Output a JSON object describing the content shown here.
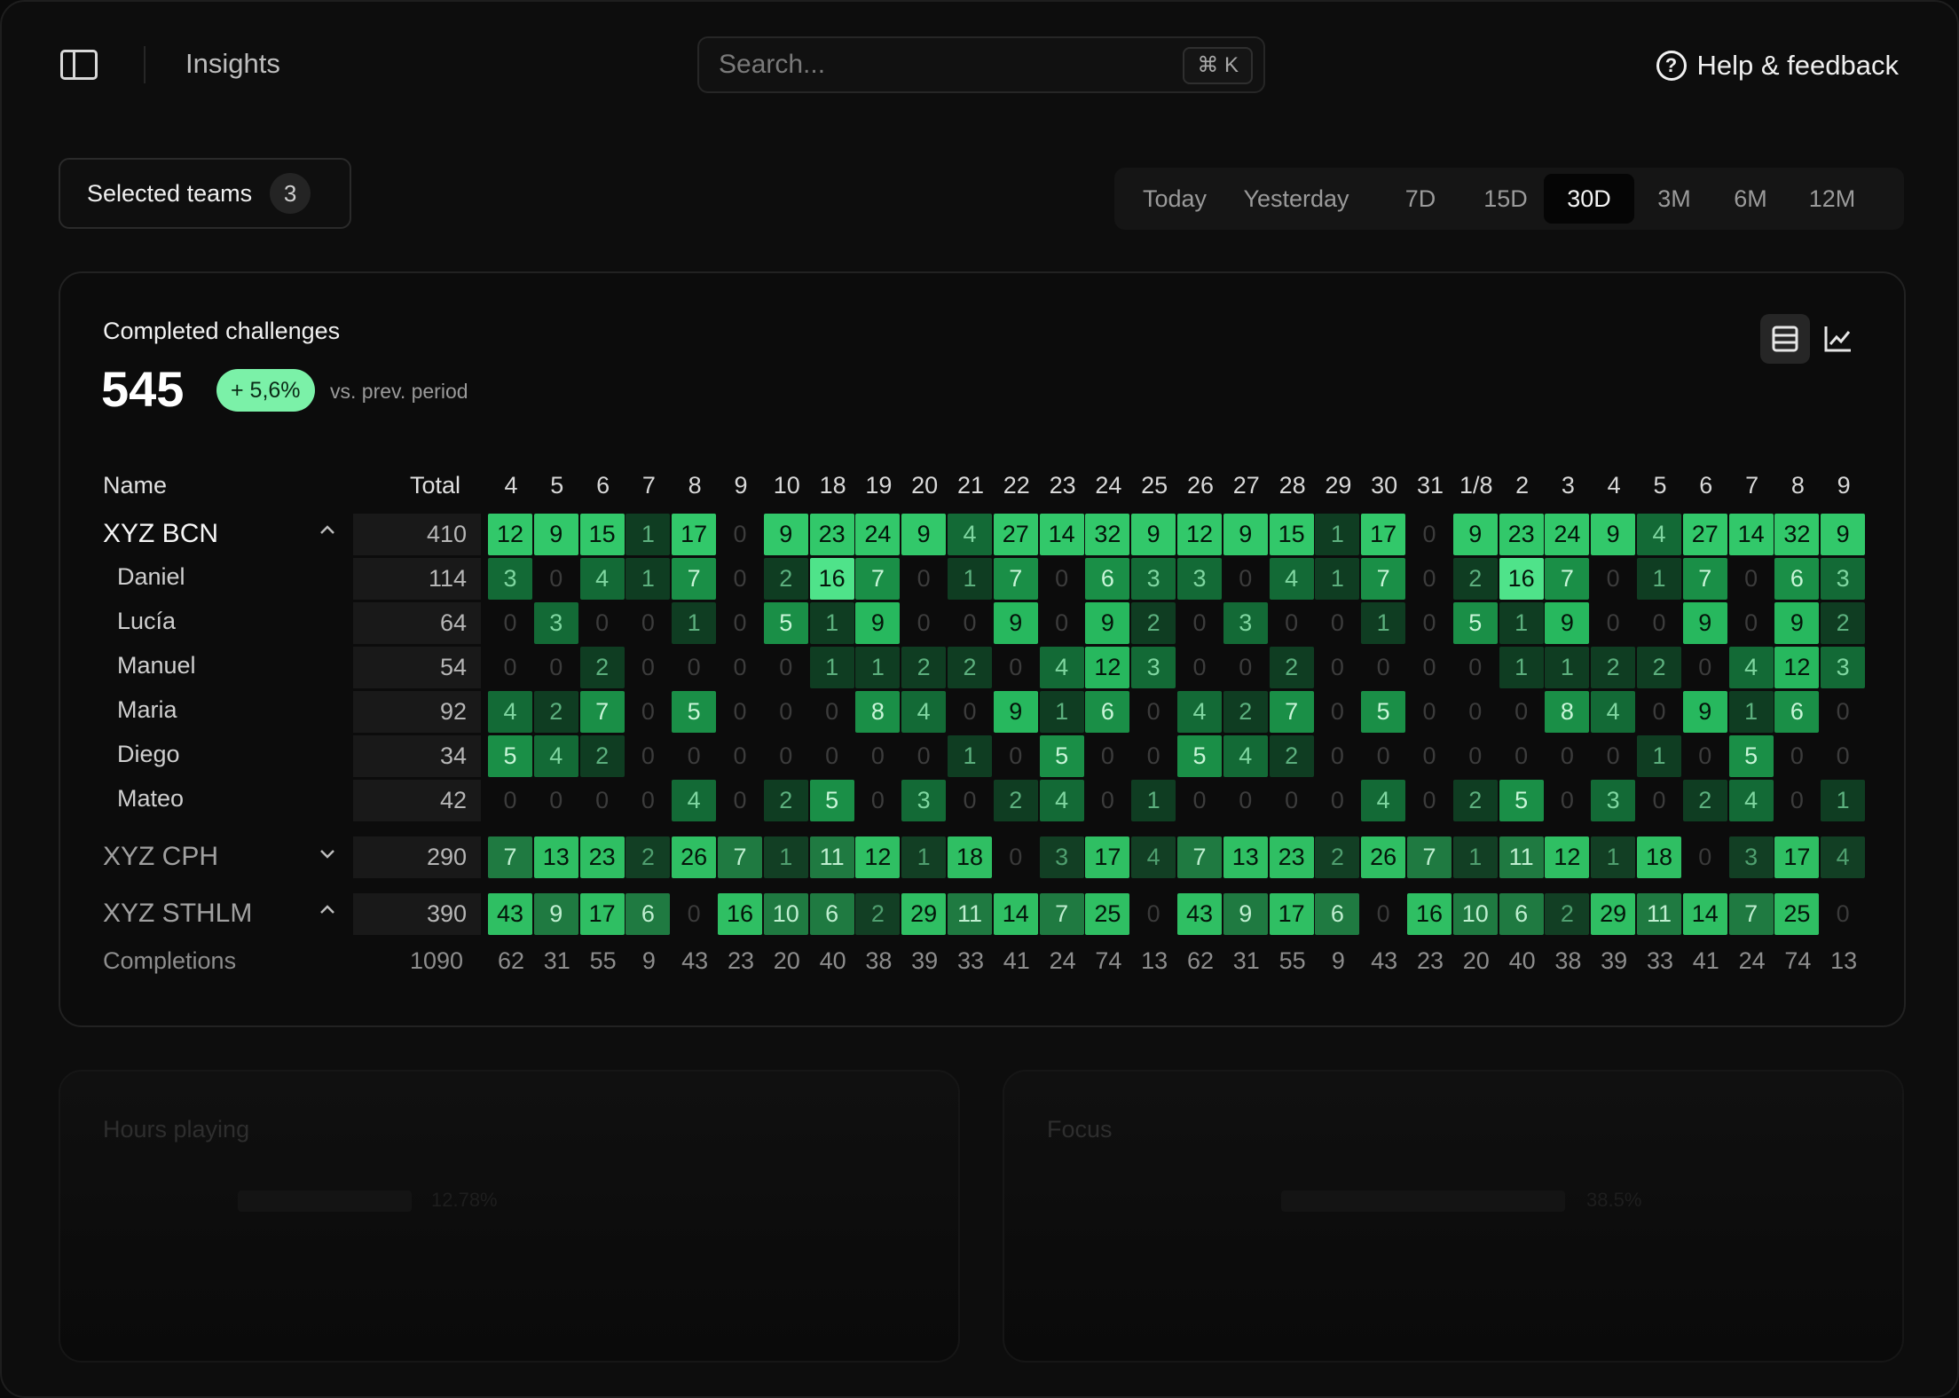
{
  "topbar": {
    "app_title": "Insights",
    "search_placeholder": "Search...",
    "search_shortcut": "⌘ K",
    "help_label": "Help & feedback",
    "help_icon": "?"
  },
  "filters": {
    "teams_label": "Selected teams",
    "teams_count": "3",
    "periods": [
      "Today",
      "Yesterday",
      "7D",
      "15D",
      "30D",
      "3M",
      "6M",
      "12M"
    ],
    "active_period": "30D"
  },
  "card": {
    "title": "Completed challenges",
    "total": "545",
    "delta": "+ 5,6%",
    "delta_note": "vs. prev. period",
    "col_name": "Name",
    "col_total": "Total",
    "days": [
      "4",
      "5",
      "6",
      "7",
      "8",
      "9",
      "10",
      "18",
      "19",
      "20",
      "21",
      "22",
      "23",
      "24",
      "25",
      "26",
      "27",
      "28",
      "29",
      "30",
      "31",
      "1/8",
      "2",
      "3",
      "4",
      "5",
      "6",
      "7",
      "8",
      "9"
    ],
    "rows": [
      {
        "name": "XYZ BCN",
        "kind": "team",
        "expanded": true,
        "total": "410",
        "values": [
          12,
          9,
          15,
          1,
          17,
          0,
          9,
          23,
          24,
          9,
          4,
          27,
          14,
          32,
          9,
          12,
          9,
          15,
          1,
          17,
          0,
          9,
          23,
          24,
          9,
          4,
          27,
          14,
          32,
          9
        ]
      },
      {
        "name": "Daniel",
        "kind": "member",
        "total": "114",
        "values": [
          3,
          0,
          4,
          1,
          7,
          0,
          2,
          16,
          7,
          0,
          1,
          7,
          0,
          6,
          3,
          3,
          0,
          4,
          1,
          7,
          0,
          2,
          16,
          7,
          0,
          1,
          7,
          0,
          6,
          3
        ]
      },
      {
        "name": "Lucía",
        "kind": "member",
        "total": "64",
        "values": [
          0,
          3,
          0,
          0,
          1,
          0,
          5,
          1,
          9,
          0,
          0,
          9,
          0,
          9,
          2,
          0,
          3,
          0,
          0,
          1,
          0,
          5,
          1,
          9,
          0,
          0,
          9,
          0,
          9,
          2
        ]
      },
      {
        "name": "Manuel",
        "kind": "member",
        "total": "54",
        "values": [
          0,
          0,
          2,
          0,
          0,
          0,
          0,
          1,
          1,
          2,
          2,
          0,
          4,
          12,
          3,
          0,
          0,
          2,
          0,
          0,
          0,
          0,
          1,
          1,
          2,
          2,
          0,
          4,
          12,
          3
        ]
      },
      {
        "name": "Maria",
        "kind": "member",
        "total": "92",
        "values": [
          4,
          2,
          7,
          0,
          5,
          0,
          0,
          0,
          8,
          4,
          0,
          9,
          1,
          6,
          0,
          4,
          2,
          7,
          0,
          5,
          0,
          0,
          0,
          8,
          4,
          0,
          9,
          1,
          6,
          0
        ]
      },
      {
        "name": "Diego",
        "kind": "member",
        "total": "34",
        "values": [
          5,
          4,
          2,
          0,
          0,
          0,
          0,
          0,
          0,
          0,
          1,
          0,
          5,
          0,
          0,
          5,
          4,
          2,
          0,
          0,
          0,
          0,
          0,
          0,
          0,
          1,
          0,
          5,
          0,
          0
        ]
      },
      {
        "name": "Mateo",
        "kind": "member",
        "total": "42",
        "values": [
          0,
          0,
          0,
          0,
          4,
          0,
          2,
          5,
          0,
          3,
          0,
          2,
          4,
          0,
          1,
          0,
          0,
          0,
          0,
          4,
          0,
          2,
          5,
          0,
          3,
          0,
          2,
          4,
          0,
          1
        ]
      },
      {
        "name": "XYZ CPH",
        "kind": "team",
        "expanded": false,
        "total": "290",
        "values": [
          7,
          13,
          23,
          2,
          26,
          7,
          1,
          11,
          12,
          1,
          18,
          0,
          3,
          17,
          4,
          7,
          13,
          23,
          2,
          26,
          7,
          1,
          11,
          12,
          1,
          18,
          0,
          3,
          17,
          4
        ]
      },
      {
        "name": "XYZ STHLM",
        "kind": "team",
        "expanded": true,
        "total": "390",
        "values": [
          43,
          9,
          17,
          6,
          0,
          16,
          10,
          6,
          2,
          29,
          11,
          14,
          7,
          25,
          0,
          43,
          9,
          17,
          6,
          0,
          16,
          10,
          6,
          2,
          29,
          11,
          14,
          7,
          25,
          0
        ]
      }
    ],
    "footer_label": "Completions",
    "footer_total": "1090",
    "footer_values": [
      "62",
      "31",
      "55",
      "9",
      "43",
      "23",
      "20",
      "40",
      "38",
      "39",
      "33",
      "41",
      "24",
      "74",
      "13",
      "62",
      "31",
      "55",
      "9",
      "43",
      "23",
      "20",
      "40",
      "38",
      "39",
      "33",
      "41",
      "24",
      "74",
      "13"
    ]
  },
  "ghost_cards": [
    {
      "title": "Hours playing",
      "value": "12.78%"
    },
    {
      "title": "Focus",
      "value": "38.5%"
    }
  ],
  "colors": {
    "accent": "#7bf1a8",
    "background": "#0d0d0d",
    "heat_dark": "#0f2a1a",
    "heat_mid": "#1a9b4a",
    "heat_bright": "#4fe38a"
  },
  "icons": {
    "sidebar_toggle": "sidebar-icon",
    "help": "help-circle-icon",
    "table_view": "table-icon",
    "chart_view": "line-chart-icon",
    "expand": "chevron-up-icon",
    "collapse": "chevron-down-icon"
  }
}
